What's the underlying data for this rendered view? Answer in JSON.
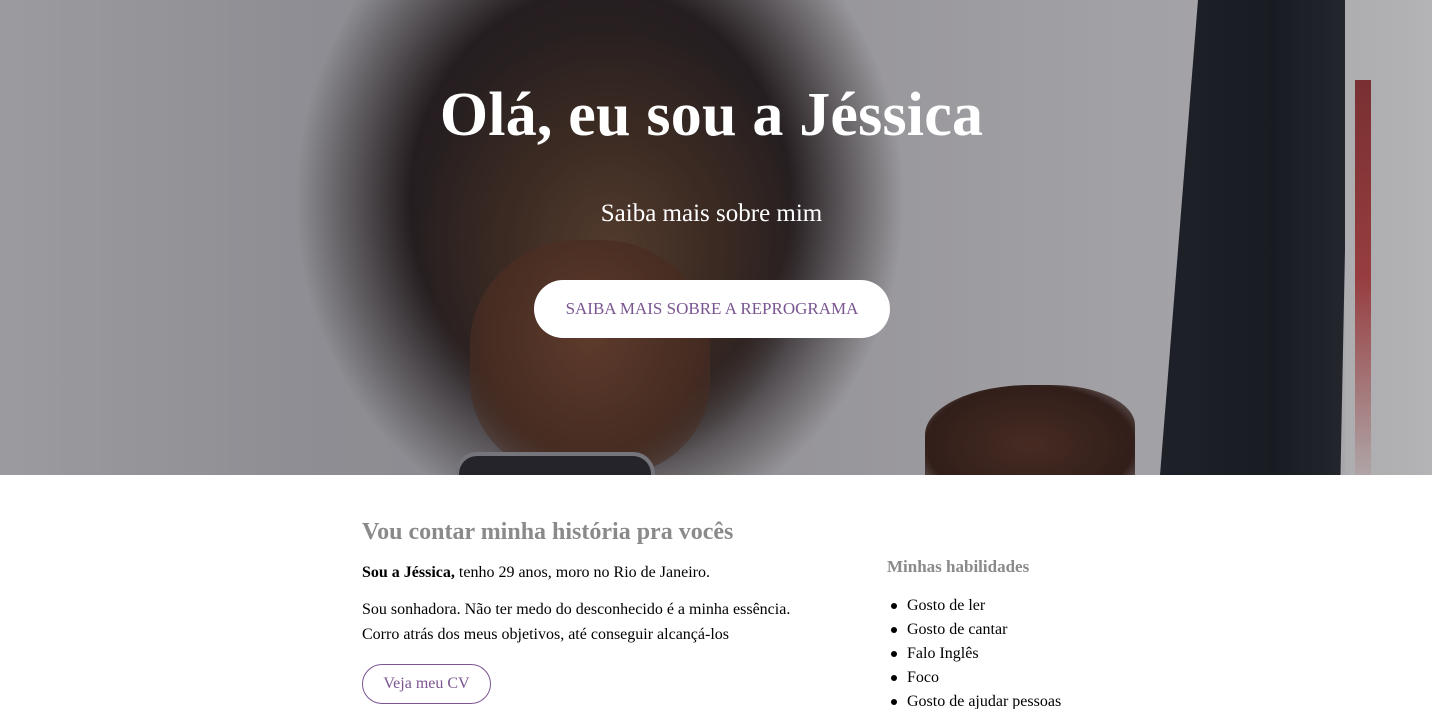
{
  "hero": {
    "title": "Olá, eu sou a Jéssica",
    "subtitle": "Saiba mais sobre mim",
    "cta_label": "SAIBA MAIS SOBRE A REPROGRAMA"
  },
  "story": {
    "heading": "Vou contar minha história pra vocês",
    "intro_bold": "Sou a Jéssica,",
    "intro_rest": " tenho 29 anos, moro no Rio de Janeiro.",
    "paragraph_line1": "Sou sonhadora. Não ter medo do desconhecido é a minha essência.",
    "paragraph_line2": "Corro atrás dos meus objetivos, até conseguir alcançá-los",
    "cv_button_label": "Veja meu CV"
  },
  "skills": {
    "heading": "Minhas habilidades",
    "items": [
      "Gosto de ler",
      "Gosto de cantar",
      "Falo Inglês",
      "Foco",
      "Gosto de ajudar pessoas"
    ]
  },
  "colors": {
    "accent": "#7a5591",
    "heading_gray": "#8a8a8a"
  }
}
